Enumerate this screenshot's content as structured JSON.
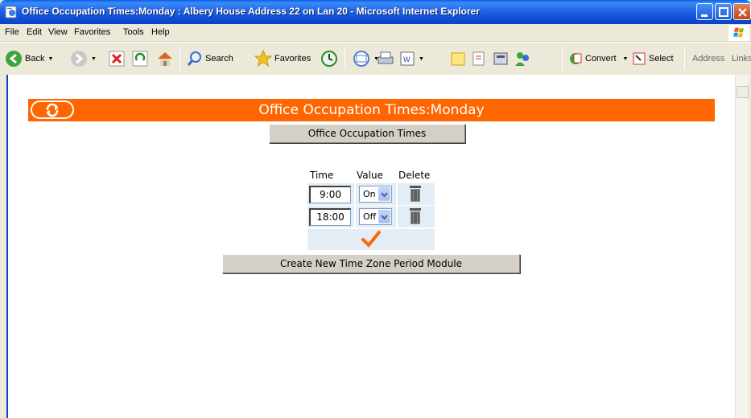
{
  "window": {
    "title": "Office Occupation Times:Monday : Albery House Address 22 on Lan 20 - Microsoft Internet Explorer"
  },
  "menu": [
    "File",
    "Edit",
    "View",
    "Favorites",
    "Tools",
    "Help"
  ],
  "toolbar": {
    "back": "Back",
    "search": "Search",
    "favorites": "Favorites",
    "convert": "Convert",
    "select": "Select",
    "address": "Address",
    "links": "Links"
  },
  "page": {
    "header_title": "Office Occupation Times:Monday",
    "parent_button": "Office Occupation Times",
    "columns": [
      "Time",
      "Value",
      "Delete"
    ],
    "rows": [
      {
        "time": "9:00",
        "value": "On"
      },
      {
        "time": "18:00",
        "value": "Off"
      }
    ],
    "create_button": "Create New Time Zone Period Module"
  },
  "colors": {
    "header": "#ff6600",
    "confirm": "#ff6600",
    "row_bg": "#e3edf5"
  }
}
